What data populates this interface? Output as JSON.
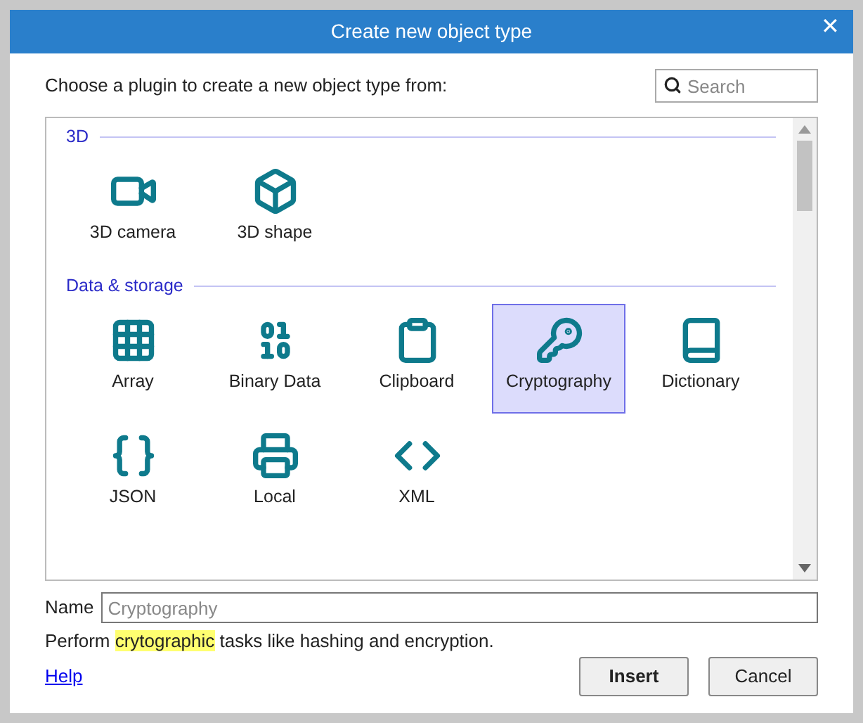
{
  "window": {
    "title": "Create new object type",
    "close": "✕"
  },
  "prompt": "Choose a plugin to create a new object type from:",
  "search": {
    "placeholder": "Search"
  },
  "sections": [
    {
      "title": "3D",
      "items": [
        {
          "label": "3D camera",
          "selected": false
        },
        {
          "label": "3D shape",
          "selected": false
        }
      ]
    },
    {
      "title": "Data & storage",
      "items": [
        {
          "label": "Array",
          "selected": false
        },
        {
          "label": "Binary Data",
          "selected": false
        },
        {
          "label": "Clipboard",
          "selected": false
        },
        {
          "label": "Cryptography",
          "selected": true
        },
        {
          "label": "Dictionary",
          "selected": false
        },
        {
          "label": "JSON",
          "selected": false
        },
        {
          "label": "Local",
          "selected": false
        },
        {
          "label": "XML",
          "selected": false
        }
      ]
    }
  ],
  "name": {
    "label": "Name",
    "placeholder": "Cryptography"
  },
  "description": [
    {
      "text": "Perform ",
      "highlighted": false
    },
    {
      "text": "crytographic",
      "highlighted": true
    },
    {
      "text": " tasks like hashing and encryption.",
      "highlighted": false
    }
  ],
  "help": "Help",
  "buttons": [
    {
      "label": "Insert",
      "default": true
    },
    {
      "label": "Cancel",
      "default": false
    }
  ]
}
